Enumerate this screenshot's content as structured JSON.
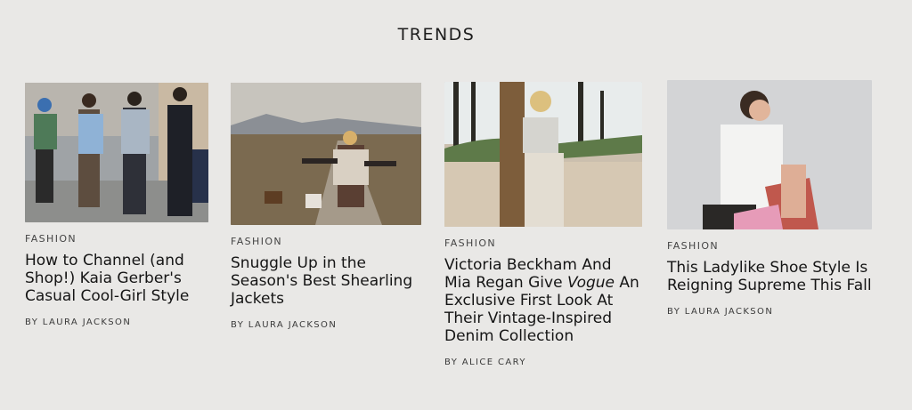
{
  "section": {
    "title": "TRENDS"
  },
  "articles": [
    {
      "category": "FASHION",
      "headline": "How to Channel (and Shop!) Kaia Gerber's Casual Cool-Girl Style",
      "byline": "BY LAURA JACKSON"
    },
    {
      "category": "FASHION",
      "headline": "Snuggle Up in the Season's Best Shearling Jackets",
      "byline": "BY LAURA JACKSON"
    },
    {
      "category": "FASHION",
      "headline_parts": [
        "Victoria Beckham And Mia Regan Give ",
        "Vogue",
        " An Exclusive First Look At Their Vintage-Inspired Denim Collection"
      ],
      "byline": "BY ALICE CARY"
    },
    {
      "category": "FASHION",
      "headline": "This Ladylike Shoe Style Is Reigning Supreme This Fall",
      "byline": "BY LAURA JACKSON"
    }
  ]
}
